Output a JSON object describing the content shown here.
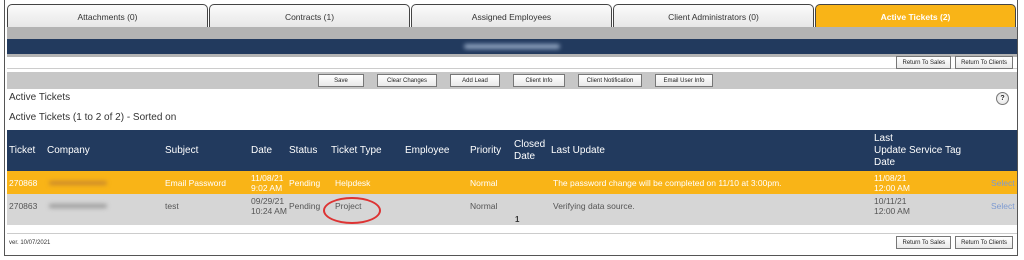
{
  "tabs": [
    {
      "label": "Attachments (0)",
      "active": false
    },
    {
      "label": "Contracts (1)",
      "active": false
    },
    {
      "label": "Assigned Employees",
      "active": false
    },
    {
      "label": "Client Administrators (0)",
      "active": false
    },
    {
      "label": "Active Tickets (2)",
      "active": true
    }
  ],
  "return_buttons": {
    "sales": "Return To Sales",
    "clients": "Return To Clients"
  },
  "toolbar": {
    "save": "Save",
    "clear_changes": "Clear Changes",
    "add_lead": "Add Lead",
    "client_info": "Client Info",
    "client_notification": "Client Notification",
    "email_user_info": "Email User Info"
  },
  "section": {
    "title": "Active Tickets",
    "help": "?",
    "subtitle": "Active Tickets (1 to 2 of 2) - Sorted on"
  },
  "columns": {
    "ticket": "Ticket",
    "company": "Company",
    "subject": "Subject",
    "date": "Date",
    "status": "Status",
    "ticket_type": "Ticket Type",
    "employee": "Employee",
    "priority": "Priority",
    "closed_date_1": "Closed",
    "closed_date_2": "Date",
    "last_update": "Last Update",
    "last_update_date_1": "Last",
    "last_update_date_2": "Update",
    "last_update_date_3": "Date",
    "service_tag": "Service Tag"
  },
  "rows": [
    {
      "ticket": "270868",
      "subject": "Email Password",
      "date1": "11/08/21",
      "date2": "9:02 AM",
      "status": "Pending",
      "type": "Helpdesk",
      "priority": "Normal",
      "last_update": "The password change will be completed on 11/10 at 3:00pm.",
      "lud1": "11/08/21",
      "lud2": "12:00 AM",
      "select": "Select"
    },
    {
      "ticket": "270863",
      "subject": "test",
      "date1": "09/29/21",
      "date2": "10:24 AM",
      "status": "Pending",
      "type": "Project",
      "priority": "Normal",
      "last_update": "Verifying data source.",
      "lud1": "10/11/21",
      "lud2": "12:00 AM",
      "select": "Select"
    }
  ],
  "pager": "1",
  "footer": {
    "version": "ver. 10/07/2021"
  },
  "colors": {
    "accent": "#f9b417",
    "header": "#223a5e",
    "annotation": "#dd3333"
  }
}
